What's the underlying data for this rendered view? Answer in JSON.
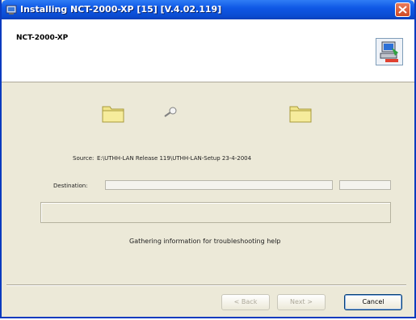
{
  "window": {
    "title": "Installing NCT-2000-XP [15] [V.4.02.119]"
  },
  "header": {
    "title": "NCT-2000-XP",
    "icon": "computer-install-icon"
  },
  "transfer": {
    "source_label": "Source:",
    "source_value": "E:\\UTHH-LAN Release 119\\UTHH-LAN-Setup 23-4-2004",
    "destination_label": "Destination:",
    "destination_value": "",
    "status": "Gathering information for troubleshooting help"
  },
  "buttons": {
    "back": "< Back",
    "next": "Next >",
    "cancel": "Cancel"
  },
  "colors": {
    "titlebar": "#0a4bd0",
    "folder": "#f0e48a",
    "close_button": "#d24b24"
  }
}
